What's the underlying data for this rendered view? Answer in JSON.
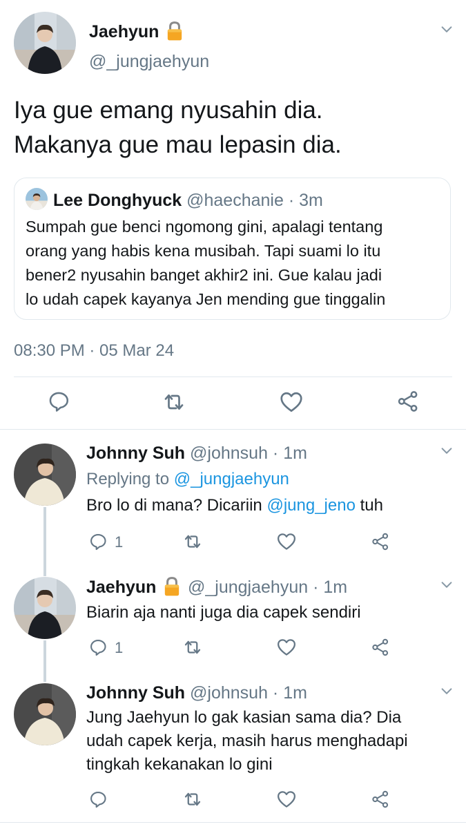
{
  "main_tweet": {
    "author_name": "Jaehyun",
    "author_handle": "@_jungjaehyun",
    "text_line1": "Iya gue emang nyusahin dia.",
    "text_line2": "Makanya gue mau lepasin dia.",
    "quote": {
      "author_name": "Lee Donghyuck",
      "author_handle": "@haechanie",
      "time": "· 3m",
      "line1": "Sumpah gue benci ngomong gini, apalagi tentang",
      "line2": "orang yang habis kena musibah. Tapi suami lo itu",
      "line3": "bener2 nyusahin banget akhir2 ini. Gue kalau jadi",
      "line4": "lo udah capek kayanya Jen mending gue tinggalin"
    },
    "timestamp": "08:30 PM · 05 Mar 24"
  },
  "replies": [
    {
      "author_name": "Johnny Suh",
      "author_handle": "@johnsuh",
      "time": "· 1m",
      "replying_label": "Replying to",
      "replying_handle": "@_jungjaehyun",
      "text_before": "Bro lo di mana? Dicariin",
      "mention": "@jung_jeno",
      "text_after": "tuh",
      "reply_count": "1"
    },
    {
      "author_name": "Jaehyun",
      "author_handle": "@_jungjaehyun",
      "time": "· 1m",
      "text": "Biarin aja nanti juga dia capek sendiri",
      "reply_count": "1"
    },
    {
      "author_name": "Johnny Suh",
      "author_handle": "@johnsuh",
      "time": "· 1m",
      "line1": "Jung Jaehyun lo gak kasian sama dia? Dia",
      "line2": "udah capek kerja, masih harus menghadapi",
      "line3": "tingkah kekanakan lo gini"
    }
  ],
  "icons": {
    "lock": "lock-icon",
    "reply": "reply-icon",
    "retweet": "retweet-icon",
    "like": "heart-icon",
    "share": "share-icon",
    "menu": "chevron-down-icon"
  },
  "colors": {
    "link": "#1b95e0",
    "secondary": "#657786",
    "lock": "#f5a623"
  }
}
